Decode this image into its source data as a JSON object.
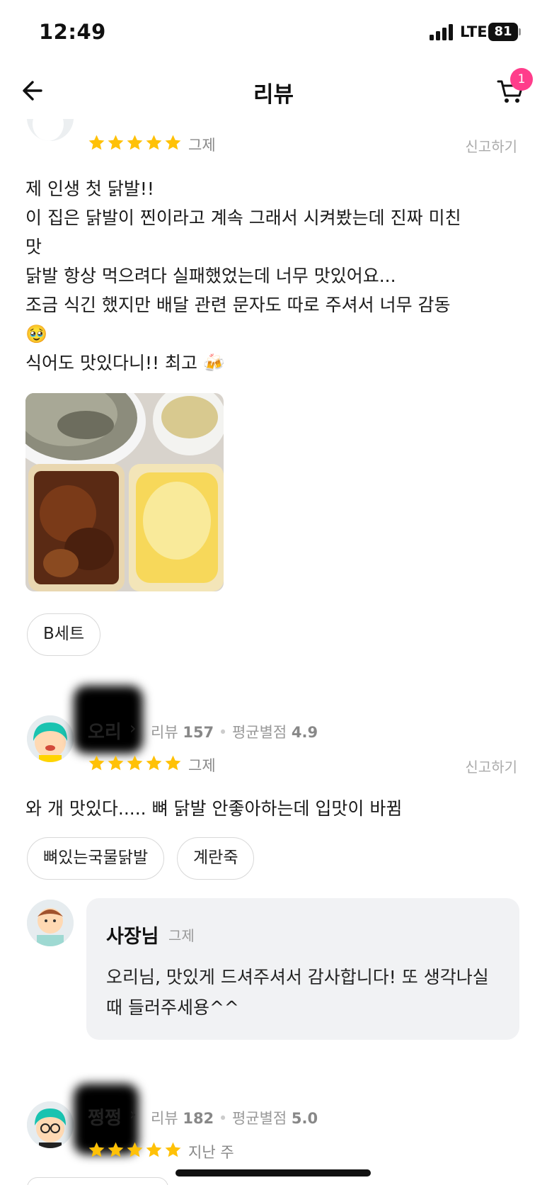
{
  "status_bar": {
    "time": "12:49",
    "network": "LTE",
    "battery": "81"
  },
  "header": {
    "title": "리뷰",
    "cart_count": "1"
  },
  "reviews": [
    {
      "rating": 5,
      "date": "그제",
      "report": "신고하기",
      "body_lines": [
        "제 인생 첫 닭발!!",
        "이 집은 닭발이 찐이라고 계속 그래서 시켜봤는데 진짜 미친",
        "맛",
        "닭발 항상 먹으려다 실패했었는데 너무 맛있어요...",
        "조금 식긴 했지만 배달 관련 문자도 따로 주셔서 너무 감동",
        "🥹",
        "식어도 맛있다니!! 최고 🍻"
      ],
      "menu_tags": [
        "B세트"
      ]
    },
    {
      "nickname": "오리",
      "review_count_label": "리뷰",
      "review_count": "157",
      "avg_label": "평균별점",
      "avg_rating": "4.9",
      "rating": 5,
      "date": "그제",
      "report": "신고하기",
      "body": "와 개 맛있다..... 뼈 닭발 안좋아하는데 입맛이 바뀜",
      "menu_tags": [
        "뼈있는국물닭발",
        "계란죽"
      ],
      "owner_reply": {
        "name": "사장님",
        "date": "그제",
        "text": "오리님, 맛있게 드셔주셔서 감사합니다! 또 생각나실 때 들러주세용^^"
      }
    },
    {
      "nickname": "쩡쩡",
      "review_count_label": "리뷰",
      "review_count": "182",
      "avg_label": "평균별점",
      "avg_rating": "5.0",
      "rating": 5,
      "date": "지난 주"
    }
  ],
  "colors": {
    "star": "#FFC107",
    "badge": "#FF3D8B",
    "owner_bg": "#F1F2F4"
  }
}
